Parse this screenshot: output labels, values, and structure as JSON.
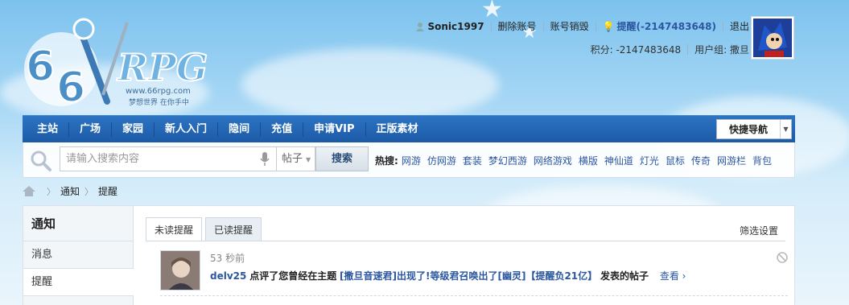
{
  "brand": {
    "logo_text": "RPG",
    "logo_number": "66",
    "logo_url_text": "www.66rpg.com",
    "logo_slogan": "梦想世界 在你手中"
  },
  "userbar": {
    "username": "Sonic1997",
    "delete_account": "删除账号",
    "account_cancel": "账号销毁",
    "remind": "提醒(-2147483648)",
    "logout": "退出",
    "points": "积分: -2147483648",
    "usergroup": "用户组: 撒旦"
  },
  "nav": {
    "items": [
      "主站",
      "广场",
      "家园",
      "新人入门",
      "隐间",
      "充值",
      "申请VIP",
      "正版素材"
    ],
    "quick_nav": "快捷导航"
  },
  "search": {
    "placeholder": "请输入搜索内容",
    "type": "帖子",
    "button": "搜索",
    "hot_label": "热搜:",
    "hot_keywords": [
      "网游",
      "仿网游",
      "套装",
      "梦幻西游",
      "网络游戏",
      "横版",
      "神仙道",
      "灯光",
      "鼠标",
      "传奇",
      "网游栏",
      "背包"
    ]
  },
  "breadcrumb": [
    "通知",
    "提醒"
  ],
  "sidebar": {
    "title": "通知",
    "items": [
      "消息",
      "提醒"
    ]
  },
  "tabs": {
    "unread": "未读提醒",
    "read": "已读提醒",
    "filter": "筛选设置"
  },
  "notice": {
    "time": "53 秒前",
    "user": "delv25",
    "action": "点评了您曾经在主题",
    "topic": "[撒旦音速君]出现了!等级君召唤出了[幽灵]【提醒负21亿】",
    "suffix": "发表的帖子",
    "view": "查看 ›"
  },
  "colors": {
    "nav_bg": "#2266b5",
    "link": "#2b57a0"
  }
}
